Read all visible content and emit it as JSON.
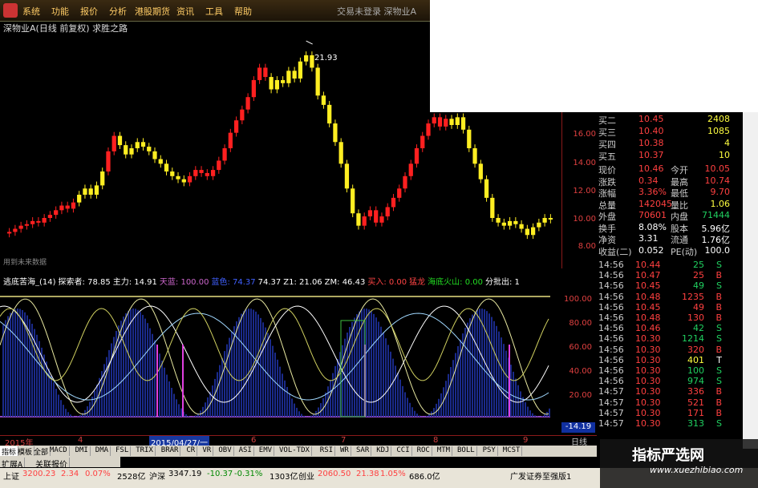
{
  "menu": {
    "items": [
      "系统",
      "功能",
      "报价",
      "分析",
      "港股期货",
      "资讯",
      "工具",
      "帮助"
    ],
    "window_title": "交易未登录   深物业A"
  },
  "chart": {
    "stock_title": "深物业A(日线 前复权) 求胜之路",
    "future_note": "用到未来数据",
    "high_label": "21.93",
    "price_ticks": [
      "16.00",
      "14.00",
      "12.00",
      "10.00",
      "8.00"
    ]
  },
  "chart_data": {
    "type": "candlestick",
    "title": "深物业A(日线 前复权)",
    "ylim": [
      7.5,
      22.5
    ],
    "x_ticks": [
      "2015年",
      "4",
      "5",
      "6",
      "7",
      "8",
      "9"
    ],
    "high_marker": 21.93,
    "close": [
      9.6,
      9.8,
      10.0,
      10.1,
      10.3,
      10.2,
      10.5,
      10.7,
      11.0,
      11.3,
      11.1,
      11.5,
      12.0,
      12.4,
      12.0,
      12.6,
      13.5,
      14.8,
      15.8,
      15.2,
      14.6,
      15.0,
      15.4,
      15.1,
      14.8,
      14.3,
      14.0,
      13.5,
      13.2,
      13.0,
      12.8,
      13.2,
      13.6,
      13.4,
      13.2,
      13.6,
      14.2,
      15.0,
      16.0,
      16.8,
      17.5,
      18.3,
      19.4,
      20.2,
      19.6,
      18.8,
      19.4,
      19.2,
      20.0,
      19.5,
      20.6,
      21.0,
      20.2,
      18.4,
      17.8,
      16.6,
      15.4,
      14.0,
      12.4,
      10.8,
      10.0,
      10.6,
      11.0,
      10.2,
      10.6,
      11.2,
      11.8,
      12.4,
      13.2,
      14.0,
      15.0,
      15.8,
      16.6,
      17.0,
      16.4,
      16.9,
      16.5,
      17.0,
      16.2,
      15.0,
      14.0,
      13.0,
      11.8,
      10.5,
      10.2,
      10.0,
      10.3,
      10.1,
      9.8,
      9.4,
      9.9,
      10.2,
      10.5,
      10.4
    ],
    "indicator": {
      "title": "逃底苦海",
      "params": [
        14
      ],
      "ylim": [
        0,
        100
      ],
      "y_ticks": [
        "100.00",
        "80.00",
        "60.00",
        "40.00",
        "20.00"
      ],
      "last_value": "-14.19"
    }
  },
  "indicator_header": [
    {
      "text": "逃底苦海_(14)",
      "color": "#fff"
    },
    {
      "text": "探索者: 78.85",
      "color": "#fff"
    },
    {
      "text": "主力: 14.91",
      "color": "#fff"
    },
    {
      "text": "天蓝: 100.00",
      "color": "#c6c"
    },
    {
      "text": "蓝色: 74.37",
      "color": "#4060ff"
    },
    {
      "text": "74.37",
      "color": "#fff"
    },
    {
      "text": "Z1: 21.06",
      "color": "#fff"
    },
    {
      "text": "ZM: 46.43",
      "color": "#fff"
    },
    {
      "text": "买入: 0.00",
      "color": "#f44"
    },
    {
      "text": "猛龙",
      "color": "#f44"
    },
    {
      "text": "海底火山: 0.00",
      "color": "#2d2"
    },
    {
      "text": "分批出: 1",
      "color": "#fff"
    }
  ],
  "quote": {
    "book": [
      {
        "label": "买二",
        "price": "10.45",
        "vol": "2408"
      },
      {
        "label": "买三",
        "price": "10.40",
        "vol": "1085"
      },
      {
        "label": "买四",
        "price": "10.38",
        "vol": "4"
      },
      {
        "label": "买五",
        "price": "10.37",
        "vol": "10"
      }
    ],
    "stats": [
      {
        "l1": "现价",
        "v1": "10.46",
        "l2": "今开",
        "v2": "10.05"
      },
      {
        "l1": "涨跌",
        "v1": "0.34",
        "l2": "最高",
        "v2": "10.74"
      },
      {
        "l1": "涨幅",
        "v1": "3.36%",
        "l2": "最低",
        "v2": "9.70"
      },
      {
        "l1": "总量",
        "v1": "142045",
        "l2": "量比",
        "v2": "1.06"
      },
      {
        "l1": "外盘",
        "v1": "70601",
        "l2": "内盘",
        "v2": "71444"
      },
      {
        "l1": "换手",
        "v1": "8.08%",
        "l2": "股本",
        "v2": "5.96亿"
      },
      {
        "l1": "净资",
        "v1": "3.31",
        "l2": "流通",
        "v2": "1.76亿"
      },
      {
        "l1": "收益(二)",
        "v1": "0.052",
        "l2": "PE(动)",
        "v2": "100.0"
      }
    ],
    "ticks": [
      {
        "t": "14:56",
        "p": "10.44",
        "v": "25",
        "d": "S"
      },
      {
        "t": "14:56",
        "p": "10.47",
        "v": "25",
        "d": "B"
      },
      {
        "t": "14:56",
        "p": "10.45",
        "v": "49",
        "d": "S"
      },
      {
        "t": "14:56",
        "p": "10.48",
        "v": "1235",
        "d": "B"
      },
      {
        "t": "14:56",
        "p": "10.45",
        "v": "49",
        "d": "B"
      },
      {
        "t": "14:56",
        "p": "10.48",
        "v": "130",
        "d": "B"
      },
      {
        "t": "14:56",
        "p": "10.46",
        "v": "42",
        "d": "S"
      },
      {
        "t": "14:56",
        "p": "10.30",
        "v": "1214",
        "d": "S"
      },
      {
        "t": "14:56",
        "p": "10.30",
        "v": "320",
        "d": "B"
      },
      {
        "t": "14:56",
        "p": "10.30",
        "v": "401",
        "d": "T"
      },
      {
        "t": "14:56",
        "p": "10.30",
        "v": "100",
        "d": "S"
      },
      {
        "t": "14:56",
        "p": "10.30",
        "v": "974",
        "d": "S"
      },
      {
        "t": "14:57",
        "p": "10.30",
        "v": "336",
        "d": "B"
      },
      {
        "t": "14:57",
        "p": "10.30",
        "v": "521",
        "d": "B"
      },
      {
        "t": "14:57",
        "p": "10.30",
        "v": "171",
        "d": "B"
      },
      {
        "t": "14:57",
        "p": "10.30",
        "v": "313",
        "d": "S"
      }
    ]
  },
  "dates": {
    "ticks": [
      "2015年",
      "4",
      "5",
      "6",
      "7",
      "8",
      "9"
    ],
    "highlight": "2015/04/27/一",
    "period": "日线"
  },
  "tabs": [
    "指标",
    "模板",
    "全部",
    "MACD",
    "DMI",
    "DMA",
    "FSL",
    "TRIX",
    "BRAR",
    "CR",
    "VR",
    "OBV",
    "ASI",
    "EMV",
    "VOL-TDX",
    "RSI",
    "WR",
    "SAR",
    "KDJ",
    "CCI",
    "ROC",
    "MTM",
    "BOLL",
    "PSY",
    "MCST"
  ],
  "tabs2": [
    "扩展A",
    "关联报价"
  ],
  "status": {
    "sh_label": "上证",
    "sh_val": "3200.23",
    "sh_chg": "2.34",
    "sh_pct": "0.07%",
    "sh_amt": "2528亿",
    "hs_label": "沪深",
    "hs_val": "3347.19",
    "hs_chg": "-10.37",
    "hs_pct": "-0.31%",
    "hs_amt": "1303亿",
    "cy_label": "创业",
    "cy_val": "2060.50",
    "cy_chg": "21.38",
    "cy_pct": "1.05%",
    "cy_amt": "686.0亿",
    "broker": "广发证券至强版1"
  },
  "watermark": {
    "title": "指标严选网",
    "url": "www.xuezhibiao.com"
  }
}
